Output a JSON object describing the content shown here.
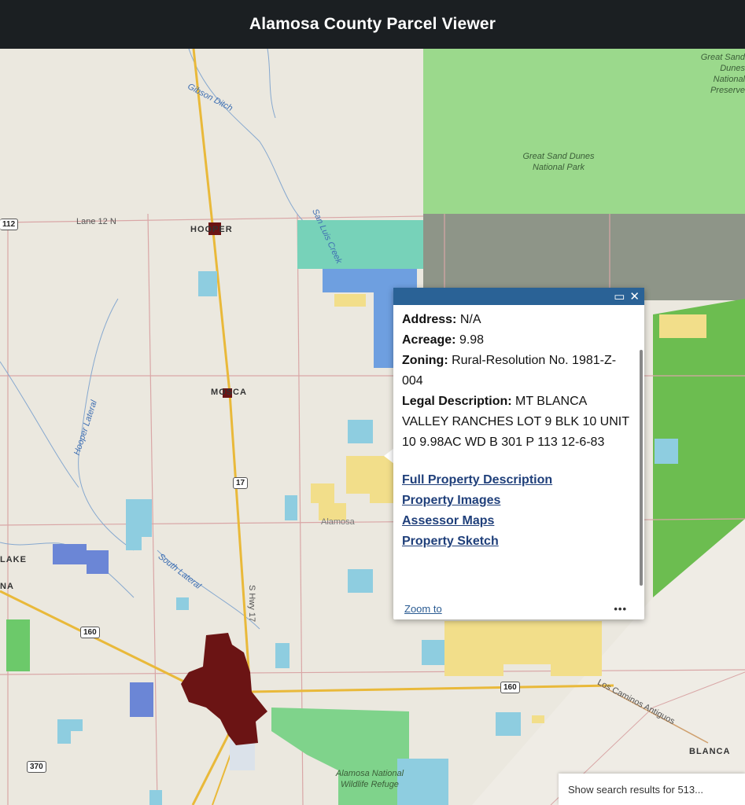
{
  "header": {
    "title": "Alamosa County Parcel Viewer"
  },
  "map": {
    "towns": {
      "hooper": "HOOPER",
      "mosca": "MOSCA",
      "alamosa": "Alamosa",
      "blanca": "BLANCA",
      "lake": "LAKE",
      "na": "NA"
    },
    "water": {
      "gibson_ditch": "Gibson Ditch",
      "san_luis_creek": "San Luis Creek",
      "hooper_lateral": "Hooper Lateral",
      "south_lateral": "South Lateral"
    },
    "parks": {
      "dunes_park": "Great Sand Dunes National Park",
      "dunes_preserve": "Great Sand Dunes National Preserve",
      "wildlife_refuge": "Alamosa National Wildlife Refuge"
    },
    "roads": {
      "lane_12n": "Lane 12 N",
      "s_hwy_17": "S Hwy 17",
      "los_caminos": "Los Caminos Antiguos"
    },
    "shields": {
      "hwy17": "17",
      "hwy160_west": "160",
      "hwy160_east": "160",
      "hwy370": "370",
      "edge_112": "112"
    }
  },
  "popup": {
    "address_label": "Address:",
    "address_value": "N/A",
    "acreage_label": "Acreage:",
    "acreage_value": "9.98",
    "zoning_label": "Zoning:",
    "zoning_value": "Rural-Resolution No. 1981-Z-004",
    "legal_label": "Legal Description:",
    "legal_value": "MT BLANCA VALLEY RANCHES LOT 9 BLK 10 UNIT 10 9.98AC WD B 301 P 113 12-6-83",
    "links": [
      "Full Property Description",
      "Property Images",
      "Assessor Maps",
      "Property Sketch"
    ],
    "zoom_to": "Zoom to",
    "more": "•••",
    "maximize_icon": "maximize-icon",
    "close_icon": "close-icon"
  },
  "search_results": {
    "label": "Show search results for 513..."
  },
  "colors": {
    "header_bg": "#1b1f22",
    "popup_bar": "#2a6296",
    "park_green": "#8fd37f",
    "dark_green": "#6abf4b",
    "town_red": "#6b1414",
    "road_yellow": "#e9b93a"
  }
}
